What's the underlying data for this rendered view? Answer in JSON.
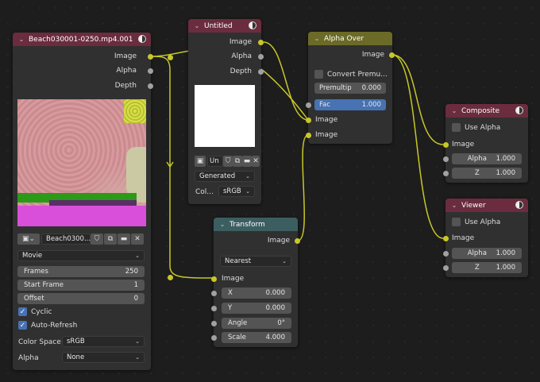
{
  "movie_node": {
    "title": "Beach030001-0250.mp4.001",
    "outputs": [
      "Image",
      "Alpha",
      "Depth"
    ],
    "image_name": "Beach0300...",
    "source": "Movie",
    "frames_label": "Frames",
    "frames_value": "250",
    "start_label": "Start Frame",
    "start_value": "1",
    "offset_label": "Offset",
    "offset_value": "0",
    "cyclic_label": "Cyclic",
    "autorefresh_label": "Auto-Refresh",
    "colorspace_label": "Color Space",
    "colorspace_value": "sRGB",
    "alpha_label": "Alpha",
    "alpha_value": "None"
  },
  "untitled_node": {
    "title": "Untitled",
    "outputs": [
      "Image",
      "Alpha",
      "Depth"
    ],
    "image_name": "Un",
    "source": "Generated",
    "colorspace_label": "Col...",
    "colorspace_value": "sRGB"
  },
  "alpha_over_node": {
    "title": "Alpha Over",
    "output": "Image",
    "convert_label": "Convert Premu...",
    "premul_label": "Premultip",
    "premul_value": "0.000",
    "fac_label": "Fac",
    "fac_value": "1.000",
    "input1": "Image",
    "input2": "Image"
  },
  "transform_node": {
    "title": "Transform",
    "output": "Image",
    "filter": "Nearest",
    "input": "Image",
    "x_label": "X",
    "x_value": "0.000",
    "y_label": "Y",
    "y_value": "0.000",
    "angle_label": "Angle",
    "angle_value": "0°",
    "scale_label": "Scale",
    "scale_value": "4.000"
  },
  "composite_node": {
    "title": "Composite",
    "use_alpha": "Use Alpha",
    "input": "Image",
    "alpha_label": "Alpha",
    "alpha_value": "1.000",
    "z_label": "Z",
    "z_value": "1.000"
  },
  "viewer_node": {
    "title": "Viewer",
    "use_alpha": "Use Alpha",
    "input": "Image",
    "alpha_label": "Alpha",
    "alpha_value": "1.000",
    "z_label": "Z",
    "z_value": "1.000"
  },
  "colors": {
    "socket_image": "#c7c729",
    "socket_value": "#a1a1a1",
    "link": "#c7c729",
    "active_field": "#4772b3"
  }
}
